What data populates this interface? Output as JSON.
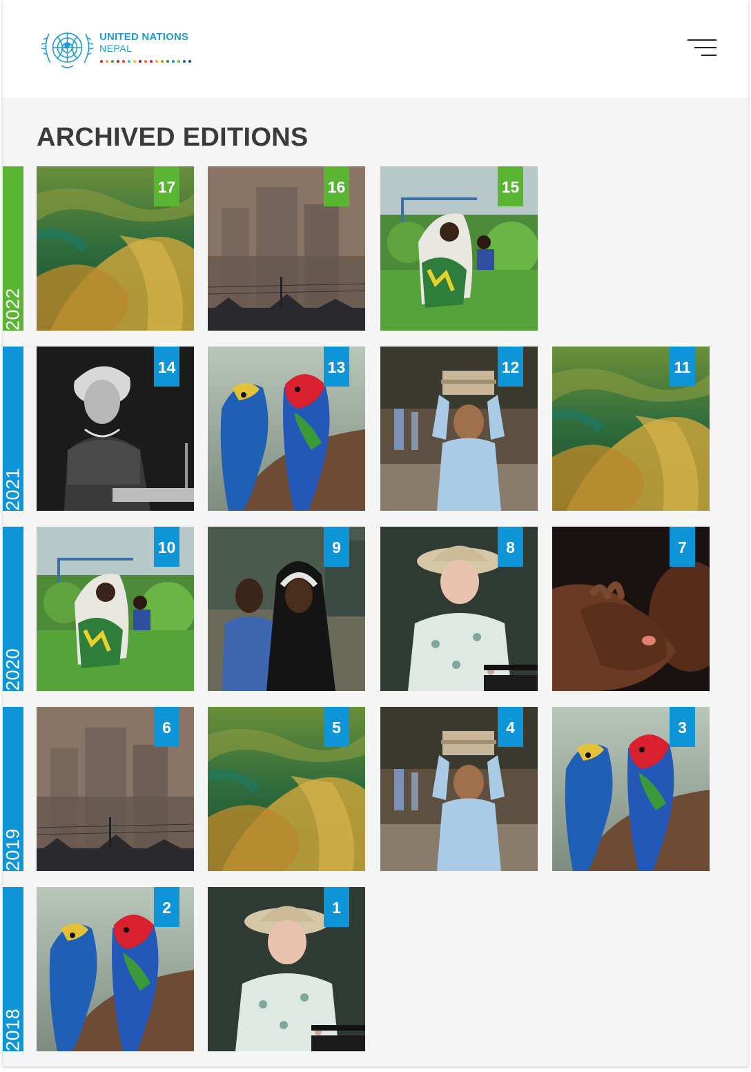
{
  "header": {
    "org_name": "UNITED NATIONS",
    "org_country": "NEPAL",
    "menu_icon": "hamburger-menu-icon",
    "sdg_dot_colors": [
      "#e5243b",
      "#dda63a",
      "#4c9f38",
      "#c5192d",
      "#ff3a21",
      "#26bde2",
      "#fcc30b",
      "#a21942",
      "#fd6925",
      "#dd1367",
      "#fd9d24",
      "#bf8b2e",
      "#3f7e44",
      "#0a97d9",
      "#56c02b",
      "#00689d",
      "#19486a"
    ]
  },
  "section_title": "ARCHIVED EDITIONS",
  "colors": {
    "accent_green": "#5ab632",
    "accent_blue": "#0d95d8",
    "background": "#f5f5f5"
  },
  "years": [
    {
      "year": "2022",
      "color": "#5ab632",
      "editions": [
        {
          "number": "17",
          "image": "kelp-seaweed-underwater"
        },
        {
          "number": "16",
          "image": "hazy-city-skyline"
        },
        {
          "number": "15",
          "image": "woman-harvesting-leaves"
        }
      ]
    },
    {
      "year": "2021",
      "color": "#0d95d8",
      "editions": [
        {
          "number": "14",
          "image": "black-white-woman-speaking"
        },
        {
          "number": "13",
          "image": "macaw-parrots"
        },
        {
          "number": "12",
          "image": "boy-carrying-books"
        },
        {
          "number": "11",
          "image": "kelp-seaweed-underwater"
        }
      ]
    },
    {
      "year": "2020",
      "color": "#0d95d8",
      "editions": [
        {
          "number": "10",
          "image": "woman-harvesting-leaves"
        },
        {
          "number": "9",
          "image": "two-students-classroom"
        },
        {
          "number": "8",
          "image": "queen-at-podium"
        },
        {
          "number": "7",
          "image": "holding-hands-dark"
        }
      ]
    },
    {
      "year": "2019",
      "color": "#0d95d8",
      "editions": [
        {
          "number": "6",
          "image": "hazy-city-skyline"
        },
        {
          "number": "5",
          "image": "kelp-seaweed-underwater"
        },
        {
          "number": "4",
          "image": "boy-carrying-books"
        },
        {
          "number": "3",
          "image": "macaw-parrots"
        }
      ]
    },
    {
      "year": "2018",
      "color": "#0d95d8",
      "editions": [
        {
          "number": "2",
          "image": "macaw-parrots"
        },
        {
          "number": "1",
          "image": "queen-at-podium"
        }
      ]
    }
  ]
}
